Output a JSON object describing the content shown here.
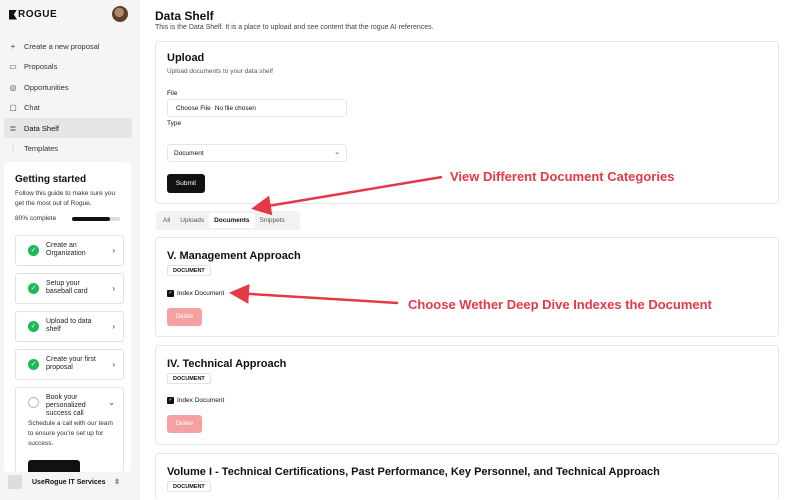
{
  "app": {
    "logo_text": "ROGUE",
    "org_name": "UseRogue IT Services"
  },
  "sidebar": {
    "items": [
      {
        "label": "Create a new proposal",
        "icon": "plus-icon"
      },
      {
        "label": "Proposals",
        "icon": "document-icon"
      },
      {
        "label": "Opportunities",
        "icon": "target-icon"
      },
      {
        "label": "Chat",
        "icon": "chat-icon"
      },
      {
        "label": "Data Shelf",
        "icon": "database-icon",
        "active": true
      },
      {
        "label": "Templates",
        "icon": "sliders-icon"
      }
    ]
  },
  "getting_started": {
    "title": "Getting started",
    "description": "Follow this guide to make sure you get the most out of Rogue.",
    "progress_label": "80% complete",
    "progress": 0.8,
    "steps": [
      {
        "label": "Create an Organization",
        "done": true
      },
      {
        "label": "Setup your baseball card",
        "done": true
      },
      {
        "label": "Upload to data shelf",
        "done": true
      },
      {
        "label": "Create your first proposal",
        "done": true
      },
      {
        "label": "Book your personalized success call",
        "done": false,
        "description": "Schedule a call with our team to ensure you're set up for success."
      }
    ]
  },
  "page": {
    "title": "Data Shelf",
    "subtitle": "This is the Data Shelf. It is a place to upload and see content that the rogue AI references."
  },
  "upload": {
    "title": "Upload",
    "subtitle": "Upload documents to your data shelf",
    "file_label": "File",
    "file_button": "Choose File",
    "file_status": "No file chosen",
    "type_label": "Type",
    "type_value": "Document",
    "submit_label": "Submit"
  },
  "tabs": [
    {
      "label": "All"
    },
    {
      "label": "Uploads"
    },
    {
      "label": "Documents",
      "active": true
    },
    {
      "label": "Snippets"
    }
  ],
  "documents": [
    {
      "title": "V. Management Approach",
      "badge": "DOCUMENT",
      "index_label": "Index Document",
      "delete_label": "Delete"
    },
    {
      "title": "IV. Technical Approach",
      "badge": "DOCUMENT",
      "index_label": "Index Document",
      "delete_label": "Delete"
    },
    {
      "title": "Volume I - Technical Certifications, Past Performance, Key Personnel, and Technical Approach",
      "badge": "DOCUMENT"
    }
  ],
  "annotations": {
    "categories": "View Different Document Categories",
    "index": "Choose Wether Deep Dive Indexes the Document",
    "color": "#e53945"
  }
}
